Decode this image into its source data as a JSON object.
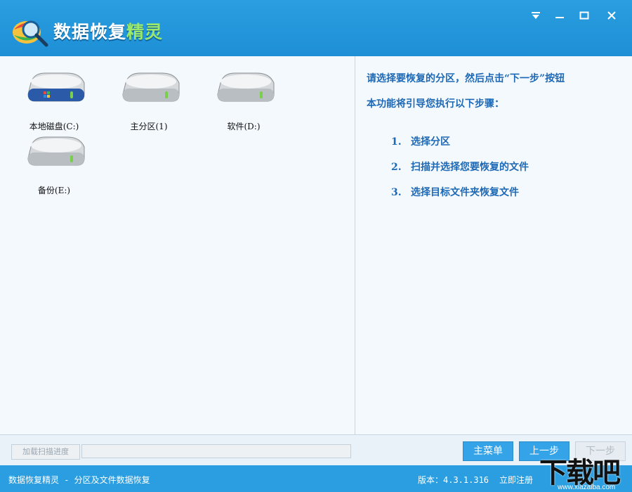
{
  "app": {
    "title_main": "数据恢复",
    "title_accent": "精灵"
  },
  "window_controls": {
    "menu_icon": "dropdown-menu-icon",
    "minimize_icon": "minimize-icon",
    "maximize_icon": "maximize-icon",
    "close_icon": "close-icon"
  },
  "drives": [
    {
      "label": "本地磁盘(C:)",
      "icon": "system-drive-icon"
    },
    {
      "label": "主分区(1)",
      "icon": "hard-drive-icon"
    },
    {
      "label": "软件(D:)",
      "icon": "hard-drive-icon"
    },
    {
      "label": "备份(E:)",
      "icon": "hard-drive-icon"
    }
  ],
  "guide": {
    "line1": "请选择要恢复的分区，然后点击“下一步”按钮",
    "line2": "本功能将引导您执行以下步骤：",
    "steps": [
      {
        "num": "1.",
        "text": "选择分区"
      },
      {
        "num": "2.",
        "text": "扫描并选择您要恢复的文件"
      },
      {
        "num": "3.",
        "text": "选择目标文件夹恢复文件"
      }
    ]
  },
  "actions": {
    "load_scan_progress": "加载扫描进度",
    "progress": 0,
    "main_menu": "主菜单",
    "prev": "上一步",
    "next": "下一步"
  },
  "status": {
    "left": "数据恢复精灵 - 分区及文件数据恢复",
    "version": "版本：4.3.1.316",
    "register": "立即注册"
  },
  "watermark": {
    "text": "下载吧",
    "url": "www.xiazaiba.com"
  },
  "colors": {
    "titlebar": "#2a9ee0",
    "accent_green": "#9be86a",
    "guide_text": "#1e69b6",
    "button_blue": "#34a3e8"
  }
}
